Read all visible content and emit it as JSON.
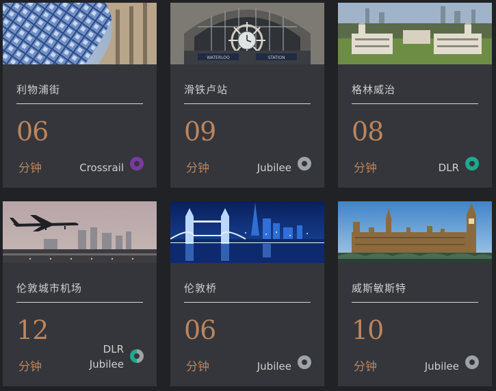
{
  "cards": [
    {
      "name": "利物浦街",
      "minutes": "06",
      "unit": "分钟",
      "lines": [
        "Crossrail"
      ],
      "dot_color": "#7b3aa0",
      "image": "gherkin-glass-tower-photo"
    },
    {
      "name": "滑铁卢站",
      "minutes": "09",
      "unit": "分钟",
      "lines": [
        "Jubilee"
      ],
      "dot_color": "#9ea3a8",
      "image": "waterloo-station-clock-photo",
      "sign_left": "WATERLOO",
      "sign_right": "STATION"
    },
    {
      "name": "格林威治",
      "minutes": "08",
      "unit": "分钟",
      "lines": [
        "DLR"
      ],
      "dot_color": "#1fa88f",
      "image": "greenwich-naval-college-photo"
    },
    {
      "name": "伦敦城市机场",
      "minutes": "12",
      "unit": "分钟",
      "lines": [
        "DLR",
        "Jubilee"
      ],
      "dot_color": "#1fa88f",
      "dot_color_2": "#9ea3a8",
      "image": "airplane-landing-photo"
    },
    {
      "name": "伦敦桥",
      "minutes": "06",
      "unit": "分钟",
      "lines": [
        "Jubilee"
      ],
      "dot_color": "#9ea3a8",
      "image": "tower-bridge-night-photo"
    },
    {
      "name": "威斯敏斯特",
      "minutes": "10",
      "unit": "分钟",
      "lines": [
        "Jubilee"
      ],
      "dot_color": "#9ea3a8",
      "image": "big-ben-parliament-photo"
    }
  ]
}
